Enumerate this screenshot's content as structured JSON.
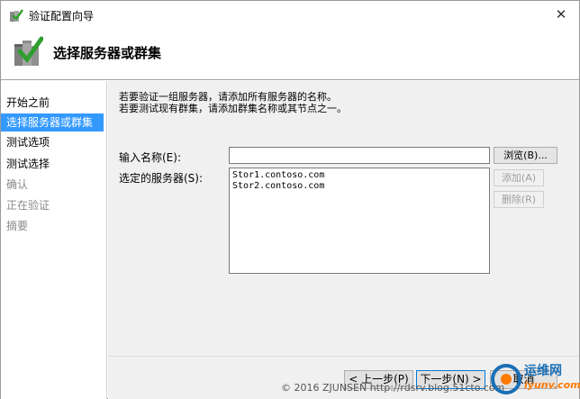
{
  "window": {
    "title": "验证配置向导",
    "close_glyph": "✕"
  },
  "header": {
    "title": "选择服务器或群集"
  },
  "sidebar": {
    "items": [
      {
        "label": "开始之前",
        "state": "normal"
      },
      {
        "label": "选择服务器或群集",
        "state": "active"
      },
      {
        "label": "测试选项",
        "state": "normal"
      },
      {
        "label": "测试选择",
        "state": "normal"
      },
      {
        "label": "确认",
        "state": "disabled"
      },
      {
        "label": "正在验证",
        "state": "disabled"
      },
      {
        "label": "摘要",
        "state": "disabled"
      }
    ]
  },
  "main": {
    "description_line1": "若要验证一组服务器，请添加所有服务器的名称。",
    "description_line2": "若要测试现有群集，请添加群集名称或其节点之一。",
    "enter_name_label": "输入名称(E):",
    "enter_name_value": "",
    "selected_servers_label": "选定的服务器(S):",
    "servers": [
      "Stor1.contoso.com",
      "Stor2.contoso.com"
    ],
    "browse_label": "浏览(B)...",
    "add_label": "添加(A)",
    "remove_label": "删除(R)"
  },
  "footer": {
    "prev_label": "< 上一步(P)",
    "next_label": "下一步(N) >",
    "cancel_label": "取消"
  },
  "overlay": {
    "watermark": "© 2016 ZJUNSEN http://rdsrv.blog.51cto.com",
    "logo_text": "运维网",
    "logo_sub": "iyunv.com"
  },
  "colors": {
    "accent": "#3399ff",
    "disabled_text": "#8a8a8a",
    "panel_bg": "#f0f0f0"
  }
}
